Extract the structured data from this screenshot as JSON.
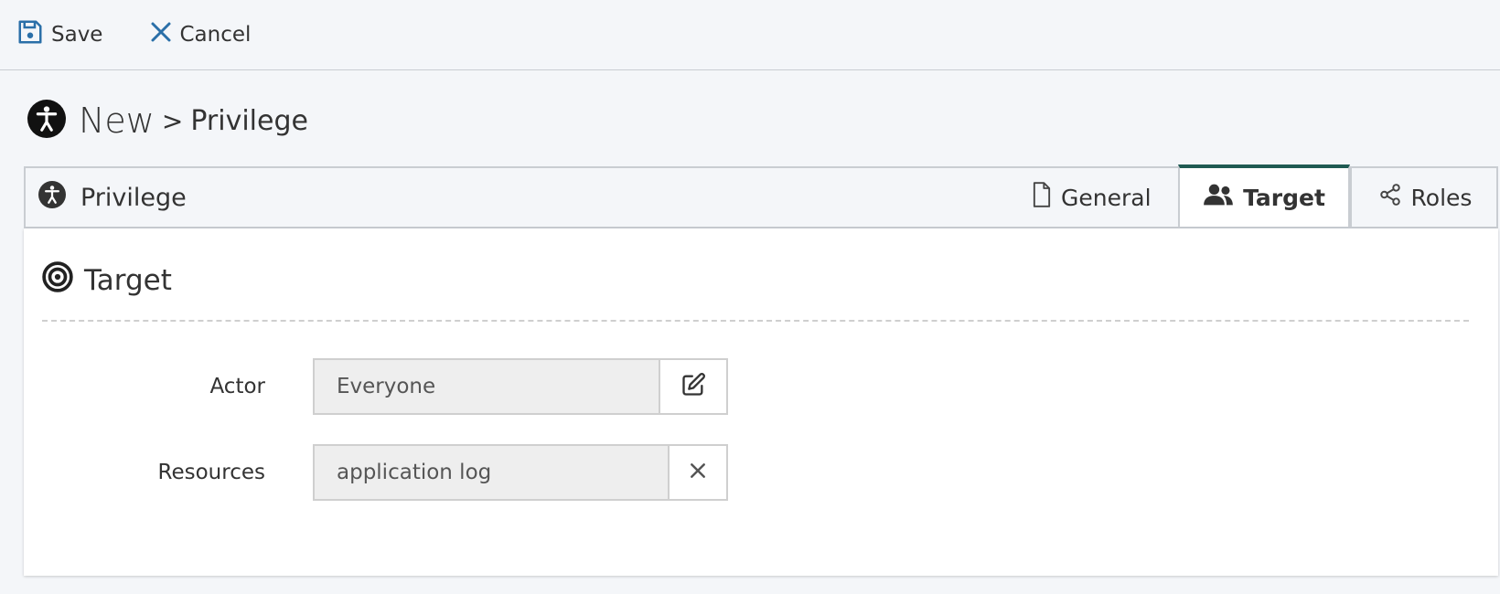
{
  "toolbar": {
    "save_label": "Save",
    "cancel_label": "Cancel"
  },
  "page": {
    "title_new": "New",
    "title_sep": ">",
    "title_entity": "Privilege"
  },
  "tabbar": {
    "title": "Privilege",
    "tabs": [
      {
        "label": "General",
        "icon": "file-icon"
      },
      {
        "label": "Target",
        "icon": "users-icon",
        "active": true
      },
      {
        "label": "Roles",
        "icon": "share-icon"
      }
    ]
  },
  "section": {
    "title": "Target",
    "icon": "bullseye-icon"
  },
  "form": {
    "actor": {
      "label": "Actor",
      "value": "Everyone",
      "action_icon": "edit-icon"
    },
    "resources": {
      "label": "Resources",
      "value": "application log",
      "action_icon": "close-icon"
    }
  },
  "colors": {
    "accent": "#1f5a52",
    "icon_blue": "#2a6fa8"
  }
}
